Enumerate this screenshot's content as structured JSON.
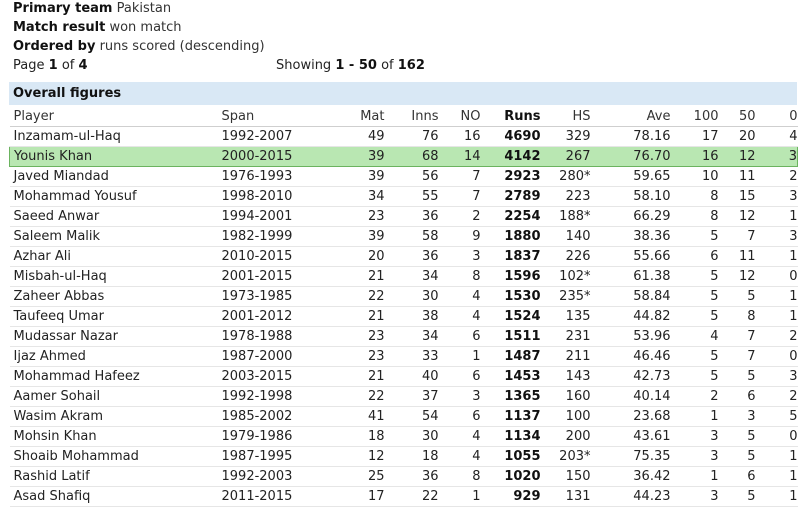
{
  "filters": {
    "primary_team_label": "Primary team",
    "primary_team_value": "Pakistan",
    "match_result_label": "Match result",
    "match_result_value": "won match",
    "ordered_by_label": "Ordered by",
    "ordered_by_value": "runs scored (descending)"
  },
  "pagination": {
    "page_label": "Page",
    "page": "1",
    "of_label": "of",
    "total_pages": "4",
    "showing_label": "Showing",
    "range": "1 - 50",
    "total_label": "of",
    "total": "162"
  },
  "panel_title": "Overall figures",
  "columns": [
    "Player",
    "Span",
    "Mat",
    "Inns",
    "NO",
    "Runs",
    "HS",
    "Ave",
    "100",
    "50",
    "0"
  ],
  "highlight_row_index": 1,
  "rows": [
    [
      "Inzamam-ul-Haq",
      "1992-2007",
      "49",
      "76",
      "16",
      "4690",
      "329",
      "78.16",
      "17",
      "20",
      "4"
    ],
    [
      "Younis Khan",
      "2000-2015",
      "39",
      "68",
      "14",
      "4142",
      "267",
      "76.70",
      "16",
      "12",
      "3"
    ],
    [
      "Javed Miandad",
      "1976-1993",
      "39",
      "56",
      "7",
      "2923",
      "280*",
      "59.65",
      "10",
      "11",
      "2"
    ],
    [
      "Mohammad Yousuf",
      "1998-2010",
      "34",
      "55",
      "7",
      "2789",
      "223",
      "58.10",
      "8",
      "15",
      "3"
    ],
    [
      "Saeed Anwar",
      "1994-2001",
      "23",
      "36",
      "2",
      "2254",
      "188*",
      "66.29",
      "8",
      "12",
      "1"
    ],
    [
      "Saleem Malik",
      "1982-1999",
      "39",
      "58",
      "9",
      "1880",
      "140",
      "38.36",
      "5",
      "7",
      "3"
    ],
    [
      "Azhar Ali",
      "2010-2015",
      "20",
      "36",
      "3",
      "1837",
      "226",
      "55.66",
      "6",
      "11",
      "1"
    ],
    [
      "Misbah-ul-Haq",
      "2001-2015",
      "21",
      "34",
      "8",
      "1596",
      "102*",
      "61.38",
      "5",
      "12",
      "0"
    ],
    [
      "Zaheer Abbas",
      "1973-1985",
      "22",
      "30",
      "4",
      "1530",
      "235*",
      "58.84",
      "5",
      "5",
      "1"
    ],
    [
      "Taufeeq Umar",
      "2001-2012",
      "21",
      "38",
      "4",
      "1524",
      "135",
      "44.82",
      "5",
      "8",
      "1"
    ],
    [
      "Mudassar Nazar",
      "1978-1988",
      "23",
      "34",
      "6",
      "1511",
      "231",
      "53.96",
      "4",
      "7",
      "2"
    ],
    [
      "Ijaz Ahmed",
      "1987-2000",
      "23",
      "33",
      "1",
      "1487",
      "211",
      "46.46",
      "5",
      "7",
      "0"
    ],
    [
      "Mohammad Hafeez",
      "2003-2015",
      "21",
      "40",
      "6",
      "1453",
      "143",
      "42.73",
      "5",
      "5",
      "3"
    ],
    [
      "Aamer Sohail",
      "1992-1998",
      "22",
      "37",
      "3",
      "1365",
      "160",
      "40.14",
      "2",
      "6",
      "2"
    ],
    [
      "Wasim Akram",
      "1985-2002",
      "41",
      "54",
      "6",
      "1137",
      "100",
      "23.68",
      "1",
      "3",
      "5"
    ],
    [
      "Mohsin Khan",
      "1979-1986",
      "18",
      "30",
      "4",
      "1134",
      "200",
      "43.61",
      "3",
      "5",
      "0"
    ],
    [
      "Shoaib Mohammad",
      "1987-1995",
      "12",
      "18",
      "4",
      "1055",
      "203*",
      "75.35",
      "3",
      "5",
      "1"
    ],
    [
      "Rashid Latif",
      "1992-2003",
      "25",
      "36",
      "8",
      "1020",
      "150",
      "36.42",
      "1",
      "6",
      "1"
    ],
    [
      "Asad Shafiq",
      "2011-2015",
      "17",
      "22",
      "1",
      "929",
      "131",
      "44.23",
      "3",
      "5",
      "1"
    ]
  ],
  "colors": {
    "panel_header_bg": "#d9e8f5",
    "highlight_bg": "#b9e7b2",
    "highlight_border": "#6bb35f"
  }
}
